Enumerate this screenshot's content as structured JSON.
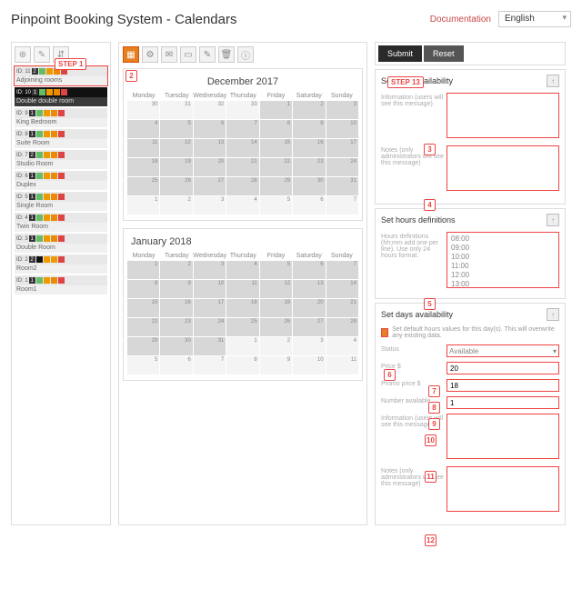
{
  "header": {
    "title": "Pinpoint Booking System - Calendars",
    "doc_link": "Documentation",
    "language": "English"
  },
  "steps": {
    "step1": "STEP 1",
    "step13": "STEP 13",
    "n2": "2",
    "n3": "3",
    "n4": "4",
    "n5": "5",
    "n6": "6",
    "n7": "7",
    "n8": "8",
    "n9": "9",
    "n10": "10",
    "n11": "11",
    "n12": "12"
  },
  "left_icons": [
    "⊕",
    "✎",
    "⇵"
  ],
  "rooms": [
    {
      "id": "ID: 11",
      "count": "2",
      "dots": [
        "dgrn",
        "dorg",
        "dora",
        "dred"
      ],
      "name": "Adjoining rooms",
      "hl": true
    },
    {
      "id": "ID: 10",
      "count": "1",
      "dots": [
        "dgrn",
        "dorg",
        "dora",
        "dred"
      ],
      "name": "Double double room",
      "sel": true
    },
    {
      "id": "ID: 9",
      "count": "1",
      "dots": [
        "dgrn",
        "dorg",
        "dora",
        "dred"
      ],
      "name": "King Bedroom"
    },
    {
      "id": "ID: 8",
      "count": "1",
      "dots": [
        "dgrn",
        "dorg",
        "dora",
        "dred"
      ],
      "name": "Suite Room"
    },
    {
      "id": "ID: 7",
      "count": "2",
      "dots": [
        "dgrn",
        "dorg",
        "dora",
        "dred"
      ],
      "name": "Studio Room"
    },
    {
      "id": "ID: 6",
      "count": "1",
      "dots": [
        "dgrn",
        "dorg",
        "dora",
        "dred"
      ],
      "name": "Duplex"
    },
    {
      "id": "ID: 5",
      "count": "1",
      "dots": [
        "dgrn",
        "dorg",
        "dora",
        "dred"
      ],
      "name": "Single Room"
    },
    {
      "id": "ID: 4",
      "count": "1",
      "dots": [
        "dgrn",
        "dorg",
        "dora",
        "dred"
      ],
      "name": "Twin Room"
    },
    {
      "id": "ID: 3",
      "count": "1",
      "dots": [
        "dgrn",
        "dorg",
        "dora",
        "dred"
      ],
      "name": "Double Room"
    },
    {
      "id": "ID: 2",
      "count": "2",
      "dots": [
        "dblk",
        "dorg",
        "dorg",
        "dred"
      ],
      "name": "Room2"
    },
    {
      "id": "ID: 1",
      "count": "1",
      "dots": [
        "dgrn",
        "dorg",
        "dora",
        "dred"
      ],
      "name": "Room1"
    }
  ],
  "toolbar_icons": [
    "▦",
    "⚙",
    "✉",
    "▭",
    "✎",
    "🗑",
    "ⓘ"
  ],
  "calendars": [
    {
      "title": "December 2017",
      "title_align": "center",
      "offset": 4,
      "days": 31,
      "prev": 3
    },
    {
      "title": "January 2018",
      "title_align": "left",
      "offset": 0,
      "days": 31,
      "prev": 0
    }
  ],
  "weekdays": [
    "Monday",
    "Tuesday",
    "Wednesday",
    "Thursday",
    "Friday",
    "Saturday",
    "Sunday"
  ],
  "right": {
    "submit": "Submit",
    "reset": "Reset",
    "panel1": {
      "title": "Set days availability",
      "info_label": "Information (users will see this message)",
      "notes_label": "Notes (only administrators will see this message)",
      "info_value": "",
      "notes_value": ""
    },
    "panel2": {
      "title": "Set hours definitions",
      "hours_label": "Hours definitions (hh:mm add one per line). Use only 24 hours format.",
      "hours_value": "08:00\n09:00\n10:00\n11:00\n12:00\n13:00"
    },
    "panel3": {
      "title": "Set days availability",
      "checkbox_label": "Set default hours values for this day(s). This will overwrite any existing data.",
      "status_label": "Status",
      "status_value": "Available",
      "price_label": "Price $",
      "price_value": "20",
      "promo_label": "Promo price $",
      "promo_value": "18",
      "avail_label": "Number available",
      "avail_value": "1",
      "info_label": "Information (users will see this message)",
      "info_value": "",
      "notes_label": "Notes (only administrators will see this message)",
      "notes_value": ""
    }
  }
}
